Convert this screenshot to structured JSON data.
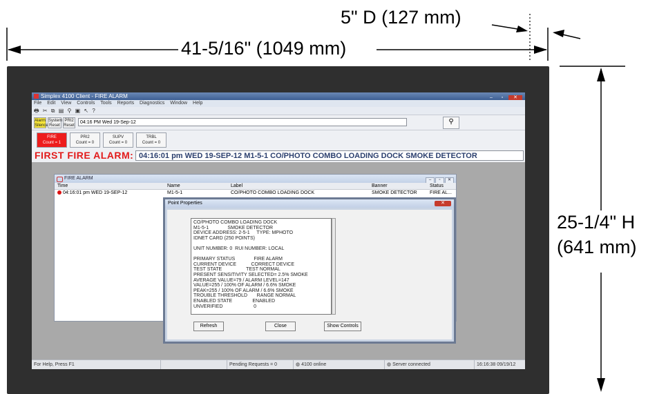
{
  "dimensions": {
    "depth": "5\" D (127 mm)",
    "width": "41-5/16\" (1049 mm)",
    "height_in": "25-1/4\" H",
    "height_mm": "(641 mm)"
  },
  "app": {
    "title": "Simplex 4100 Client - FIRE ALARM",
    "window_buttons": [
      "–",
      "▫",
      "✕"
    ],
    "menu": [
      "File",
      "Edit",
      "View",
      "Controls",
      "Tools",
      "Reports",
      "Diagnostics",
      "Window",
      "Help"
    ],
    "toolbar_icons": [
      "printer-icon",
      "cut-icon",
      "copy-icon",
      "paste-icon",
      "find-icon",
      "print-preview-icon",
      "pointer-icon",
      "help-icon"
    ],
    "buttons": {
      "alarm_silence": "Alarm Silence",
      "system_reset": "System Reset",
      "pri2_reset": "PRI2 Reset"
    },
    "datetime_field": "04:16 PM Wed 19-Sep-12",
    "counters": [
      {
        "name": "FIRE",
        "count": "Count = 1"
      },
      {
        "name": "PRI2",
        "count": "Count = 0"
      },
      {
        "name": "SUPV",
        "count": "Count = 0"
      },
      {
        "name": "TRBL",
        "count": "Count = 0"
      }
    ],
    "first_alarm_label": "FIRST FIRE ALARM:",
    "first_alarm_text": "04:16:01 pm WED 19-SEP-12 M1-5-1 CO/PHOTO COMBO LOADING DOCK SMOKE DETECTOR"
  },
  "fire_alarm_window": {
    "title": "FIRE ALARM",
    "columns": [
      "Time",
      "Name",
      "Label",
      "Banner",
      "Status"
    ],
    "rows": [
      {
        "time": "04:16:01 pm WED 19-SEP-12",
        "name": "M1-5-1",
        "label": "CO/PHOTO COMBO LOADING DOCK",
        "banner": "SMOKE DETECTOR",
        "status": "FIRE AL..."
      }
    ]
  },
  "point_properties": {
    "title": "Point Properties",
    "lines": [
      "CO/PHOTO COMBO LOADING DOCK",
      "M1-5-1              SMOKE DETECTOR",
      "DEVICE ADDRESS: 2-5-1     TYPE: MPHOTO",
      "IDNET CARD (250 POINTS)",
      "",
      "UNIT NUMBER: 0  RUI NUMBER: LOCAL",
      "",
      "PRIMARY STATUS              FIRE ALARM",
      "CURRENT DEVICE           CORRECT DEVICE",
      "TEST STATE                  TEST NORMAL",
      "PRESENT SENSITIVITY SELECTED= 2.5% SMOKE",
      "AVERAGE VALUE=79 / ALARM LEVEL=147",
      "VALUE=255 / 100% OF ALARM / 6.6% SMOKE",
      "PEAK=255 / 100% OF ALARM / 6.6% SMOKE",
      "TROUBLE THRESHOLD       RANGE NORMAL",
      "ENABLED STATE               ENABLED",
      "UNVERIFIED                       0"
    ],
    "buttons": {
      "refresh": "Refresh",
      "close": "Close",
      "show_controls": "Show Controls"
    }
  },
  "status_bar": {
    "help": "For Help, Press F1",
    "pending": "Pending Requests = 0",
    "panel": "4100 online",
    "server": "Server connected",
    "clock": "16:16:38  09/19/12"
  }
}
